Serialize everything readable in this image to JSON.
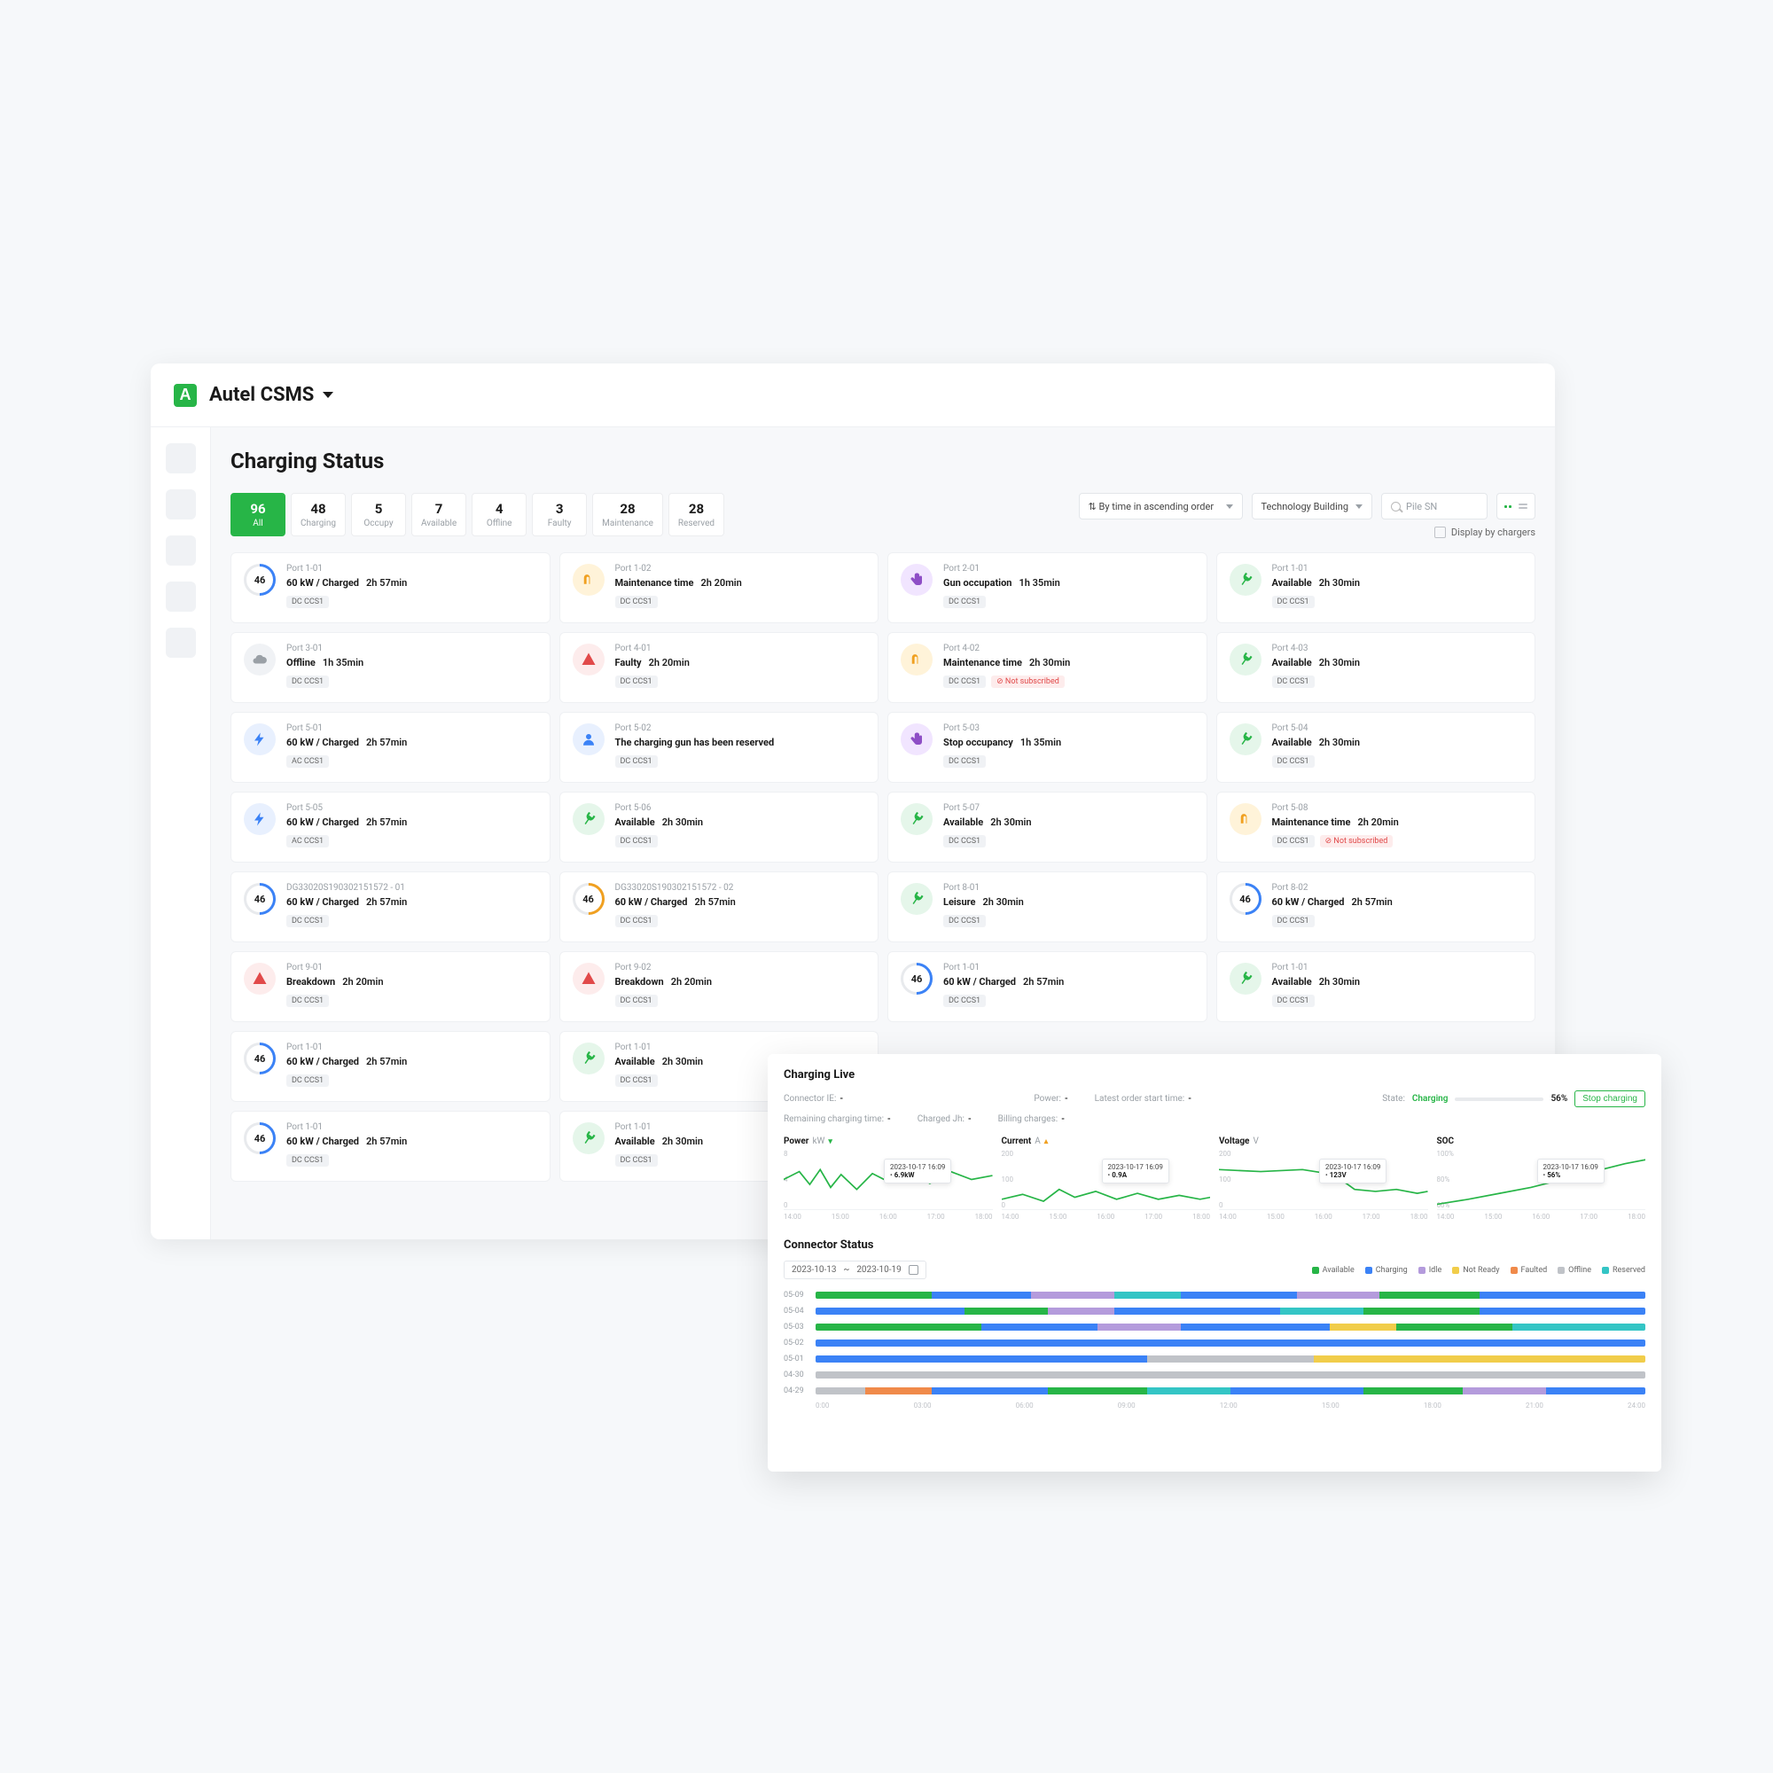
{
  "app": {
    "title": "Autel CSMS"
  },
  "page": {
    "title": "Charging Status"
  },
  "tabs": [
    {
      "n": "96",
      "l": "All",
      "active": true
    },
    {
      "n": "48",
      "l": "Charging"
    },
    {
      "n": "5",
      "l": "Occupy"
    },
    {
      "n": "7",
      "l": "Available"
    },
    {
      "n": "4",
      "l": "Offline"
    },
    {
      "n": "3",
      "l": "Faulty"
    },
    {
      "n": "28",
      "l": "Maintenance"
    },
    {
      "n": "28",
      "l": "Reserved"
    }
  ],
  "filters": {
    "sort_prefix": "⇅",
    "sort": "By time in ascending order",
    "location": "Technology Building",
    "search_placeholder": "Pile SN",
    "display_by": "Display by chargers"
  },
  "cards": [
    {
      "port": "Port 1-01",
      "status": "60 kW / Charged",
      "time": "2h 57min",
      "badge": "DC CCS1",
      "icon": "ring",
      "ring": "46",
      "ringc": "#3b82f6"
    },
    {
      "port": "Port 1-02",
      "status": "Maintenance time",
      "time": "2h 20min",
      "badge": "DC CCS1",
      "icon": "wrench"
    },
    {
      "port": "Port 2-01",
      "status": "Gun occupation",
      "time": "1h 35min",
      "badge": "DC CCS1",
      "icon": "hand"
    },
    {
      "port": "Port 1-01",
      "status": "Available",
      "time": "2h 30min",
      "badge": "DC CCS1",
      "icon": "plug-g"
    },
    {
      "port": "Port 3-01",
      "status": "Offline",
      "time": "1h 35min",
      "badge": "DC CCS1",
      "icon": "cloud"
    },
    {
      "port": "Port 4-01",
      "status": "Faulty",
      "time": "2h 20min",
      "badge": "DC CCS1",
      "icon": "alert"
    },
    {
      "port": "Port 4-02",
      "status": "Maintenance time",
      "time": "2h 30min",
      "badge": "DC CCS1",
      "icon": "wrench",
      "err": "Not subscribed"
    },
    {
      "port": "Port 4-03",
      "status": "Available",
      "time": "2h 30min",
      "badge": "DC CCS1",
      "icon": "plug-g"
    },
    {
      "port": "Port 5-01",
      "status": "60 kW / Charged",
      "time": "2h 57min",
      "badge": "AC CCS1",
      "icon": "plug-b",
      "glyph": "⚡"
    },
    {
      "port": "Port 5-02",
      "status": "The charging gun has been reserved",
      "time": "",
      "badge": "DC CCS1",
      "icon": "person"
    },
    {
      "port": "Port 5-03",
      "status": "Stop  occupancy",
      "time": "1h 35min",
      "badge": "DC CCS1",
      "icon": "hand"
    },
    {
      "port": "Port 5-04",
      "status": "Available",
      "time": "2h 30min",
      "badge": "DC CCS1",
      "icon": "plug-g"
    },
    {
      "port": "Port 5-05",
      "status": "60 kW / Charged",
      "time": "2h 57min",
      "badge": "AC CCS1",
      "icon": "plug-b",
      "glyph": "⚡"
    },
    {
      "port": "Port 5-06",
      "status": "Available",
      "time": "2h 30min",
      "badge": "DC CCS1",
      "icon": "plug-g"
    },
    {
      "port": "Port 5-07",
      "status": "Available",
      "time": "2h 30min",
      "badge": "DC CCS1",
      "icon": "plug-g"
    },
    {
      "port": "Port 5-08",
      "status": "Maintenance time",
      "time": "2h 20min",
      "badge": "DC CCS1",
      "icon": "wrench",
      "err": "Not subscribed"
    },
    {
      "port": "DG33020S190302151572 - 01",
      "status": "60 kW / Charged",
      "time": "2h 57min",
      "badge": "DC CCS1",
      "icon": "ring",
      "ring": "46",
      "ringc": "#3b82f6"
    },
    {
      "port": "DG33020S190302151572 - 02",
      "status": "60 kW / Charged",
      "time": "2h 57min",
      "badge": "DC CCS1",
      "icon": "ring",
      "ring": "46",
      "ringc": "#f0a020"
    },
    {
      "port": "Port 8-01",
      "status": "Leisure",
      "time": "2h 30min",
      "badge": "DC CCS1",
      "icon": "plug-g"
    },
    {
      "port": "Port 8-02",
      "status": "60 kW / Charged",
      "time": "2h 57min",
      "badge": "DC CCS1",
      "icon": "ring",
      "ring": "46",
      "ringc": "#3b82f6"
    },
    {
      "port": "Port 9-01",
      "status": "Breakdown",
      "time": "2h 20min",
      "badge": "DC CCS1",
      "icon": "alert"
    },
    {
      "port": "Port 9-02",
      "status": "Breakdown",
      "time": "2h 20min",
      "badge": "DC CCS1",
      "icon": "alert"
    },
    {
      "port": "Port 1-01",
      "status": "60 kW / Charged",
      "time": "2h 57min",
      "badge": "DC CCS1",
      "icon": "ring",
      "ring": "46",
      "ringc": "#3b82f6"
    },
    {
      "port": "Port 1-01",
      "status": "Available",
      "time": "2h 30min",
      "badge": "DC CCS1",
      "icon": "plug-g"
    },
    {
      "port": "Port 1-01",
      "status": "60 kW / Charged",
      "time": "2h 57min",
      "badge": "DC CCS1",
      "icon": "ring",
      "ring": "46",
      "ringc": "#3b82f6"
    },
    {
      "port": "Port 1-01",
      "status": "Available",
      "time": "2h 30min",
      "badge": "DC CCS1",
      "icon": "plug-g"
    },
    {
      "port": "",
      "status": "",
      "time": "",
      "badge": "",
      "icon": "",
      "hidden": true
    },
    {
      "port": "",
      "status": "",
      "time": "",
      "badge": "",
      "icon": "",
      "hidden": true
    },
    {
      "port": "Port 1-01",
      "status": "60 kW / Charged",
      "time": "2h 57min",
      "badge": "DC CCS1",
      "icon": "ring",
      "ring": "46",
      "ringc": "#3b82f6"
    },
    {
      "port": "Port 1-01",
      "status": "Available",
      "time": "2h 30min",
      "badge": "DC CCS1",
      "icon": "plug-g"
    },
    {
      "port": "",
      "status": "",
      "time": "",
      "badge": "",
      "icon": "",
      "hidden": true
    },
    {
      "port": "",
      "status": "",
      "time": "",
      "badge": "",
      "icon": "",
      "hidden": true
    }
  ],
  "float": {
    "title": "Charging Live",
    "row1": {
      "connector": "Connector IE:",
      "remaining": "Remaining charging time:",
      "power": "Power:",
      "charged": "Charged Jh:",
      "latest": "Latest order start time:",
      "billing": "Billing charges:"
    },
    "state": {
      "label": "State:",
      "value": "Charging",
      "pct": "56%",
      "stop": "Stop charging"
    },
    "charts": [
      {
        "title": "Power",
        "unit": "kW",
        "trend": "down",
        "tooltip_t": "2023-10-17 16:09",
        "tooltip_v": "6.9kW",
        "ymax": "8",
        "ymid": "4",
        "ymin": "0",
        "xticks": [
          "14:00",
          "15:00",
          "16:00",
          "17:00",
          "18:00"
        ]
      },
      {
        "title": "Current",
        "unit": "A",
        "trend": "up",
        "tooltip_t": "2023-10-17 16:09",
        "tooltip_v": "0.9A",
        "ymax": "200",
        "ymid": "100",
        "ymin": "0",
        "xticks": [
          "14:00",
          "15:00",
          "16:00",
          "17:00",
          "18:00"
        ]
      },
      {
        "title": "Voltage",
        "unit": "V",
        "trend": "",
        "tooltip_t": "2023-10-17 16:09",
        "tooltip_v": "123V",
        "ymax": "200",
        "ymid": "100",
        "ymin": "0",
        "xticks": [
          "14:00",
          "15:00",
          "16:00",
          "17:00",
          "18:00"
        ]
      },
      {
        "title": "SOC",
        "unit": "",
        "trend": "",
        "tooltip_t": "2023-10-17 16:09",
        "tooltip_v": "56%",
        "ymax": "100%",
        "ymid": "80%",
        "ymin": "60%",
        "xticks": [
          "14:00",
          "15:00",
          "16:00",
          "17:00",
          "18:00"
        ]
      }
    ],
    "conn_title": "Connector Status",
    "date_from": "2023-10-13",
    "date_to": "2023-10-19",
    "legend": [
      {
        "c": "c-avail",
        "l": "Available"
      },
      {
        "c": "c-chg",
        "l": "Charging"
      },
      {
        "c": "c-idle",
        "l": "Idle"
      },
      {
        "c": "c-nr",
        "l": "Not Ready"
      },
      {
        "c": "c-fault",
        "l": "Faulted"
      },
      {
        "c": "c-off",
        "l": "Offline"
      },
      {
        "c": "c-res",
        "l": "Reserved"
      }
    ],
    "timeline_labels": [
      "05-09",
      "05-04",
      "05-03",
      "05-02",
      "05-01",
      "04-30",
      "04-29"
    ],
    "timeline_ticks": [
      "0:00",
      "03:00",
      "06:00",
      "09:00",
      "12:00",
      "15:00",
      "18:00",
      "21:00",
      "24:00"
    ],
    "timeline_rows": [
      [
        {
          "c": "c-avail",
          "w": 14
        },
        {
          "c": "c-chg",
          "w": 12
        },
        {
          "c": "c-idle",
          "w": 10
        },
        {
          "c": "c-res",
          "w": 8
        },
        {
          "c": "c-chg",
          "w": 14
        },
        {
          "c": "c-idle",
          "w": 10
        },
        {
          "c": "c-avail",
          "w": 12
        },
        {
          "c": "c-chg",
          "w": 20
        }
      ],
      [
        {
          "c": "c-chg",
          "w": 18
        },
        {
          "c": "c-avail",
          "w": 10
        },
        {
          "c": "c-idle",
          "w": 8
        },
        {
          "c": "c-chg",
          "w": 20
        },
        {
          "c": "c-res",
          "w": 10
        },
        {
          "c": "c-avail",
          "w": 14
        },
        {
          "c": "c-chg",
          "w": 20
        }
      ],
      [
        {
          "c": "c-avail",
          "w": 20
        },
        {
          "c": "c-chg",
          "w": 14
        },
        {
          "c": "c-idle",
          "w": 10
        },
        {
          "c": "c-chg",
          "w": 18
        },
        {
          "c": "c-nr",
          "w": 8
        },
        {
          "c": "c-avail",
          "w": 14
        },
        {
          "c": "c-res",
          "w": 16
        }
      ],
      [
        {
          "c": "c-chg",
          "w": 100
        }
      ],
      [
        {
          "c": "c-chg",
          "w": 40
        },
        {
          "c": "c-off",
          "w": 20
        },
        {
          "c": "c-nr",
          "w": 40
        }
      ],
      [
        {
          "c": "c-off",
          "w": 100
        }
      ],
      [
        {
          "c": "c-off",
          "w": 6
        },
        {
          "c": "c-fault",
          "w": 8
        },
        {
          "c": "c-chg",
          "w": 14
        },
        {
          "c": "c-avail",
          "w": 12
        },
        {
          "c": "c-res",
          "w": 10
        },
        {
          "c": "c-chg",
          "w": 16
        },
        {
          "c": "c-avail",
          "w": 12
        },
        {
          "c": "c-idle",
          "w": 10
        },
        {
          "c": "c-chg",
          "w": 12
        }
      ]
    ]
  }
}
